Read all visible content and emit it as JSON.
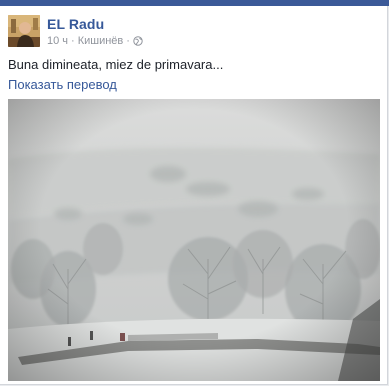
{
  "post": {
    "author": "EL Radu",
    "time": "10 ч",
    "location": "Кишинёв",
    "separator": "·",
    "privacy_icon": "globe-icon",
    "text": "Buna dimineata, miez de primavara...",
    "translate_link": "Показать перевод",
    "photo_description_icon": "snowy-landscape-photo"
  },
  "colors": {
    "brand": "#3b5998",
    "link": "#365899",
    "muted": "#90949c",
    "text": "#1d2129"
  }
}
